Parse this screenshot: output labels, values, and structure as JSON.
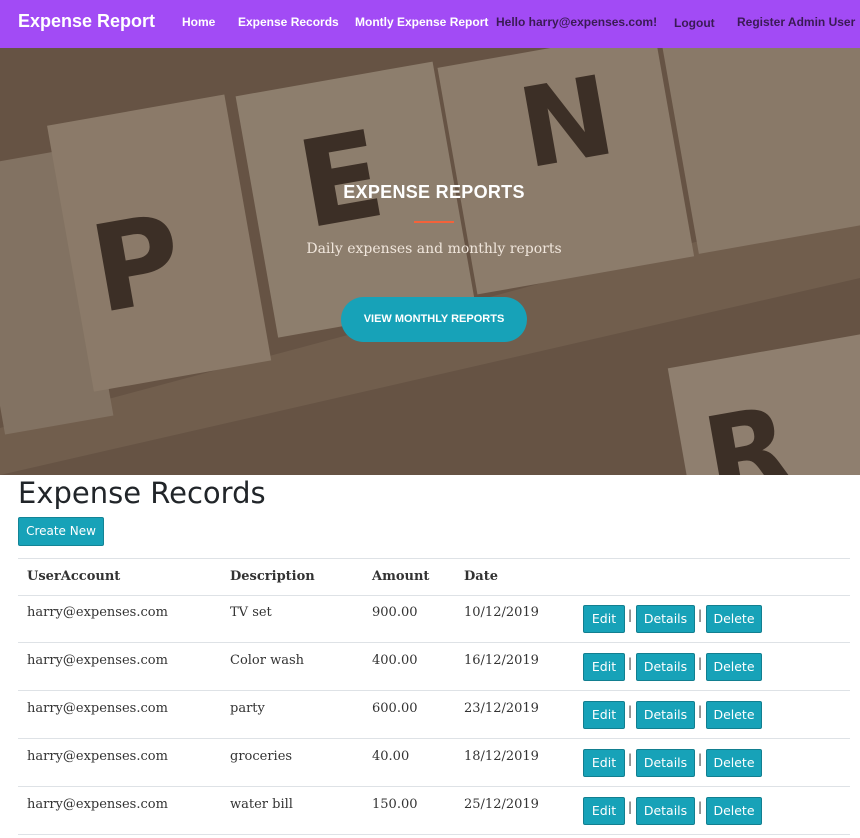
{
  "nav": {
    "brand": "Expense Report",
    "links": [
      "Home",
      "Expense Records",
      "Montly Expense Report"
    ],
    "greeting": "Hello harry@expenses.com!",
    "logout": "Logout",
    "register": "Register Admin User"
  },
  "hero": {
    "title": "EXPENSE REPORTS",
    "subtitle": "Daily expenses and monthly reports",
    "button": "VIEW MONTHLY REPORTS"
  },
  "page": {
    "title": "Expense Records",
    "create_button": "Create New"
  },
  "table": {
    "headers": [
      "UserAccount",
      "Description",
      "Amount",
      "Date"
    ],
    "rows": [
      {
        "user": "harry@expenses.com",
        "description": "TV set",
        "amount": "900.00",
        "date": "10/12/2019"
      },
      {
        "user": "harry@expenses.com",
        "description": "Color wash",
        "amount": "400.00",
        "date": "16/12/2019"
      },
      {
        "user": "harry@expenses.com",
        "description": "party",
        "amount": "600.00",
        "date": "23/12/2019"
      },
      {
        "user": "harry@expenses.com",
        "description": "groceries",
        "amount": "40.00",
        "date": "18/12/2019"
      },
      {
        "user": "harry@expenses.com",
        "description": "water bill",
        "amount": "150.00",
        "date": "25/12/2019"
      }
    ],
    "actions": {
      "edit": "Edit",
      "details": "Details",
      "delete": "Delete",
      "separator": "|"
    }
  },
  "colors": {
    "navbar": "#a24bf5",
    "accent": "#17a2b8",
    "divider": "#f4623a"
  },
  "hero_image_letters": [
    "P",
    "E",
    "N",
    "R"
  ]
}
